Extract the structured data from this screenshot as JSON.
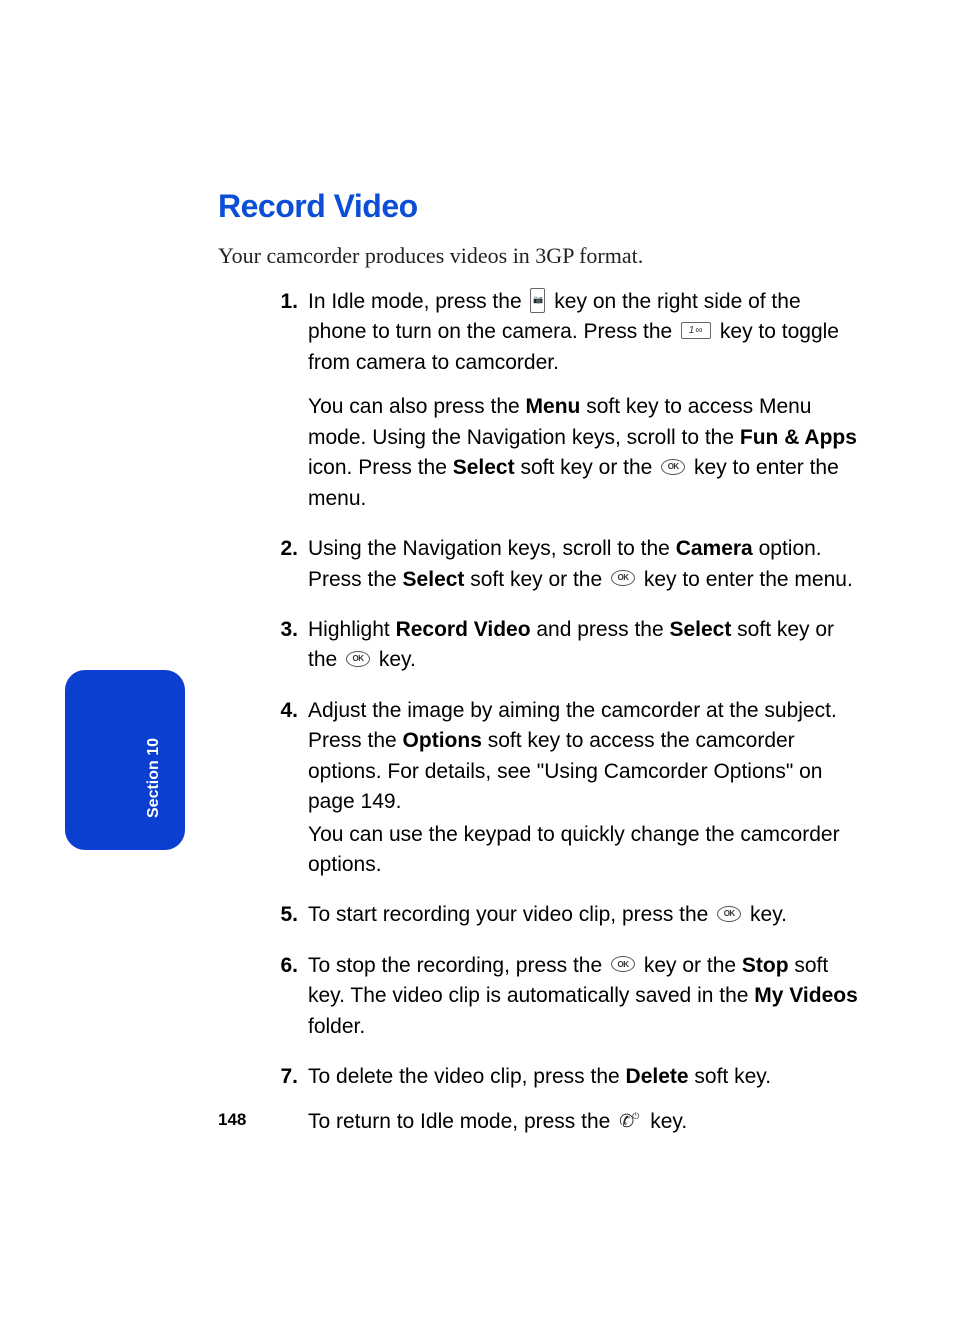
{
  "title": "Record Video",
  "intro": "Your camcorder produces videos in 3GP format.",
  "section_tab": "Section 10",
  "page_number": "148",
  "steps": {
    "s1": {
      "num": "1.",
      "t1": "In Idle mode, press the ",
      "t2": " key on the right side of the phone to turn on the camera. Press the ",
      "t3": " key to toggle from camera to camcorder.",
      "p2a": "You can also press the ",
      "p2b": "Menu",
      "p2c": " soft key to access Menu mode. Using the Navigation keys, scroll to the ",
      "p2d": "Fun & Apps",
      "p2e": " icon. Press the ",
      "p2f": "Select",
      "p2g": " soft key or the ",
      "p2h": " key to enter the menu."
    },
    "s2": {
      "num": "2.",
      "a": "Using the Navigation keys, scroll to the ",
      "b": "Camera",
      "c": " option. Press the ",
      "d": "Select",
      "e": " soft key or the ",
      "f": " key to enter the menu."
    },
    "s3": {
      "num": "3.",
      "a": "Highlight ",
      "b": "Record Video",
      "c": " and press the ",
      "d": "Select",
      "e": " soft key or the ",
      "f": " key."
    },
    "s4": {
      "num": "4.",
      "a": "Adjust the image by aiming the camcorder at the subject. Press the ",
      "b": "Options",
      "c": " soft key to access the camcorder options. For details, see \"Using Camcorder Options\" on page 149.",
      "p2": "You can use the keypad to quickly change the camcorder options."
    },
    "s5": {
      "num": "5.",
      "a": "To start recording your video clip, press the ",
      "b": " key."
    },
    "s6": {
      "num": "6.",
      "a": "To stop the recording, press the ",
      "b": " key or the ",
      "c": "Stop",
      "d": " soft key. The video clip is automatically saved in the ",
      "e": "My Videos",
      "f": " folder."
    },
    "s7": {
      "num": "7.",
      "a": "To delete the video clip, press the ",
      "b": "Delete",
      "c": " soft key.",
      "p2a": "To return to Idle mode, press the ",
      "p2b": " key."
    }
  },
  "icons": {
    "one_key_label": "1∞",
    "ok_label": "OK"
  }
}
